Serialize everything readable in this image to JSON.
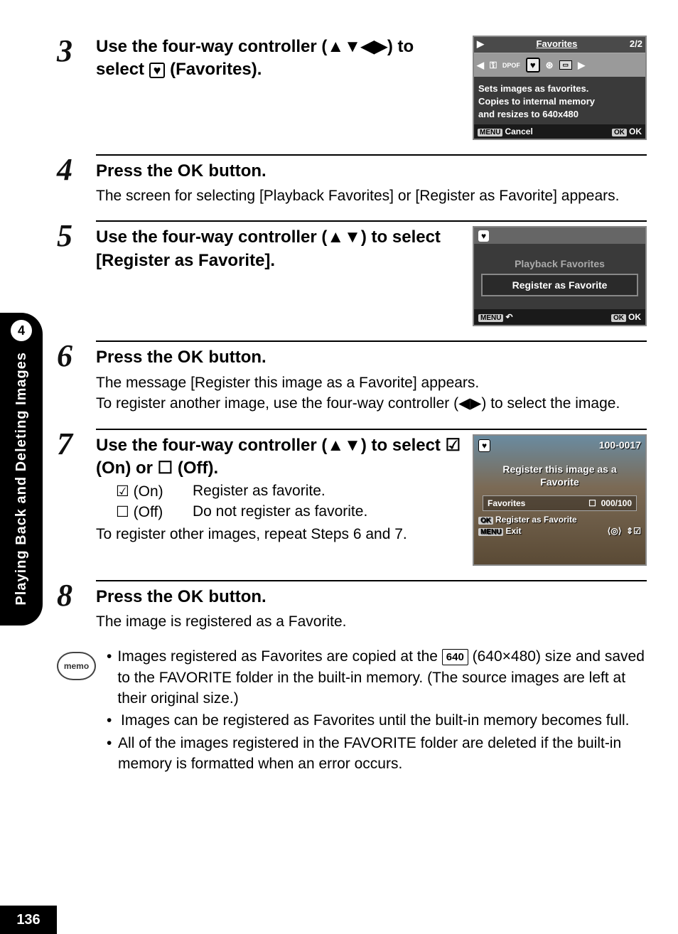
{
  "sidebar": {
    "chapter_number": "4",
    "chapter_title": "Playing Back and Deleting Images"
  },
  "page_number": "136",
  "steps": {
    "s3": {
      "num": "3",
      "title_a": "Use the four-way controller (",
      "title_arrows": "▲▼◀▶",
      "title_b": ") to select ",
      "title_icon": "♥",
      "title_c": " (Favorites)."
    },
    "s4": {
      "num": "4",
      "title_a": "Press the ",
      "title_ok": "OK",
      "title_b": " button.",
      "desc": "The screen for selecting [Playback Favorites] or [Register as Favorite] appears."
    },
    "s5": {
      "num": "5",
      "title": "Use the four-way controller (▲▼) to select [Register as Favorite]."
    },
    "s6": {
      "num": "6",
      "title_a": "Press the ",
      "title_ok": "OK",
      "title_b": " button.",
      "desc": "The message [Register this image as a Favorite] appears.\nTo register another image, use the four-way controller (◀▶) to select the image."
    },
    "s7": {
      "num": "7",
      "title": "Use the four-way controller (▲▼) to select ☑ (On) or ☐ (Off).",
      "on_label": "☑ (On)",
      "on_desc": "Register as favorite.",
      "off_label": "☐ (Off)",
      "off_desc": "Do not register as favorite.",
      "repeat": "To register other images, repeat Steps 6 and 7."
    },
    "s8": {
      "num": "8",
      "title_a": "Press the ",
      "title_ok": "OK",
      "title_b": " button.",
      "desc": "The image is registered as a Favorite."
    }
  },
  "lcd1": {
    "title": "Favorites",
    "page": "2/2",
    "desc1": "Sets images as favorites.",
    "desc2": "Copies to internal memory",
    "desc3": "and resizes to 640x480",
    "menu_label": "MENU",
    "cancel": "Cancel",
    "ok_label": "OK",
    "ok_text": "OK"
  },
  "lcd2": {
    "item1": "Playback Favorites",
    "item2": "Register as Favorite",
    "menu_label": "MENU",
    "ok_label": "OK",
    "ok_text": "OK"
  },
  "lcd3": {
    "file_no": "100-0017",
    "msg1": "Register this image as a",
    "msg2": "Favorite",
    "fav_label": "Favorites",
    "fav_count": "000/100",
    "ok_label": "OK",
    "reg_text": "Register as Favorite",
    "menu_label": "MENU",
    "exit": "Exit"
  },
  "memo": {
    "label": "memo",
    "b1a": "Images registered as Favorites are copied at the ",
    "b1_size": "640",
    "b1b": " (640×480) size and saved to the FAVORITE folder in the built-in memory. (The source images are left at their original size.)",
    "b2": "Images can be registered as Favorites until the built-in memory becomes full.",
    "b3": "All of the images registered in the FAVORITE folder are deleted if the built-in memory is formatted when an error occurs."
  }
}
